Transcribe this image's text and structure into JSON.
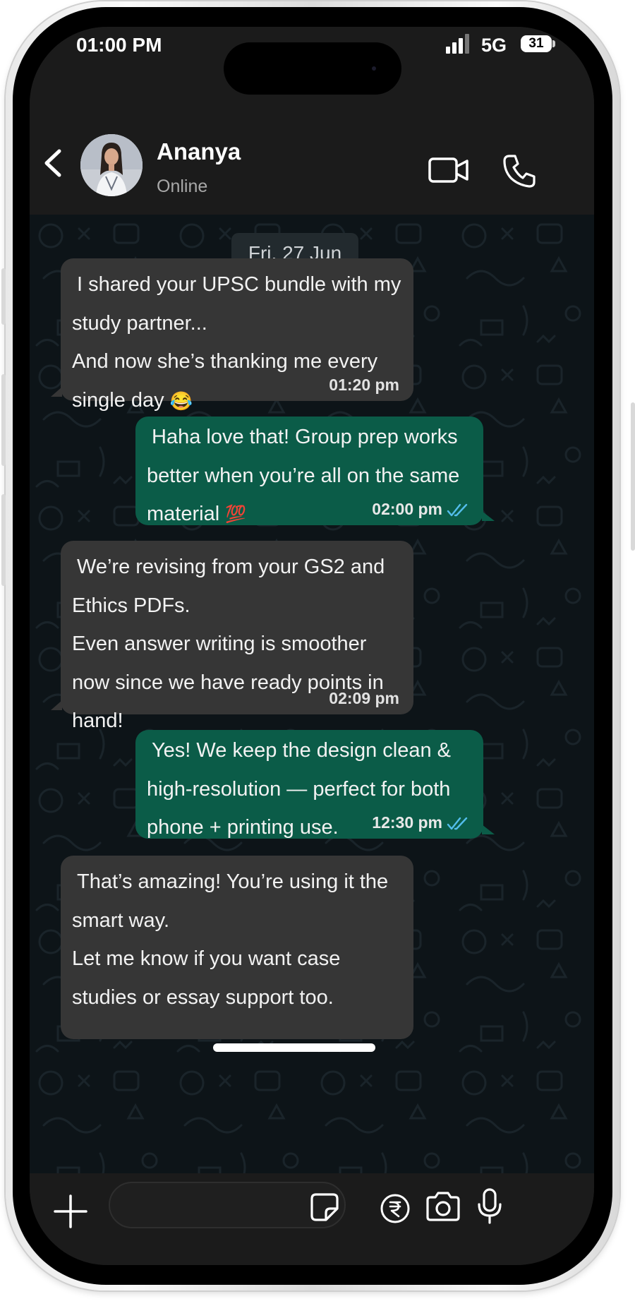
{
  "status_bar": {
    "time": "01:00 PM",
    "network": "5G",
    "battery": "31"
  },
  "header": {
    "contact_name": "Ananya",
    "contact_status": "Online"
  },
  "date_divider": "Fri, 27 Jun",
  "messages": [
    {
      "direction": "incoming",
      "lines": [
        "I shared your UPSC bundle with my",
        "study partner...",
        "And now she’s thanking me every",
        "single day"
      ],
      "emoji": "😂",
      "time": "01:20 pm"
    },
    {
      "direction": "outgoing",
      "lines": [
        "Haha love that! Group prep works",
        "better when you’re all on the same",
        "material"
      ],
      "emoji": "💯",
      "time": "02:00 pm",
      "read": true
    },
    {
      "direction": "incoming",
      "lines": [
        "We’re revising from your GS2 and",
        "Ethics PDFs.",
        "Even answer writing is smoother",
        "now since we have ready points in",
        "hand!"
      ],
      "time": "02:09 pm"
    },
    {
      "direction": "outgoing",
      "lines": [
        "Yes! We keep the design clean &",
        "high-resolution — perfect for both",
        "phone + printing use."
      ],
      "time": "12:30 pm",
      "read": true
    },
    {
      "direction": "incoming",
      "lines": [
        "That’s amazing! You’re using it the",
        "smart way.",
        "Let me know if you want case",
        "studies or essay support too."
      ]
    }
  ],
  "composer": {
    "input_value": "",
    "input_placeholder": ""
  },
  "icons": {
    "back": "chevron-left-icon",
    "video": "video-camera-icon",
    "call": "phone-icon",
    "attach": "plus-icon",
    "sticker": "sticker-icon",
    "payment": "rupee-icon",
    "camera": "camera-icon",
    "mic": "microphone-icon"
  },
  "colors": {
    "incoming_bubble": "#363636",
    "outgoing_bubble": "#0b5c48",
    "chat_background": "#0d1418",
    "read_tick": "#53bdeb",
    "app_bar": "#1b1b1b"
  }
}
